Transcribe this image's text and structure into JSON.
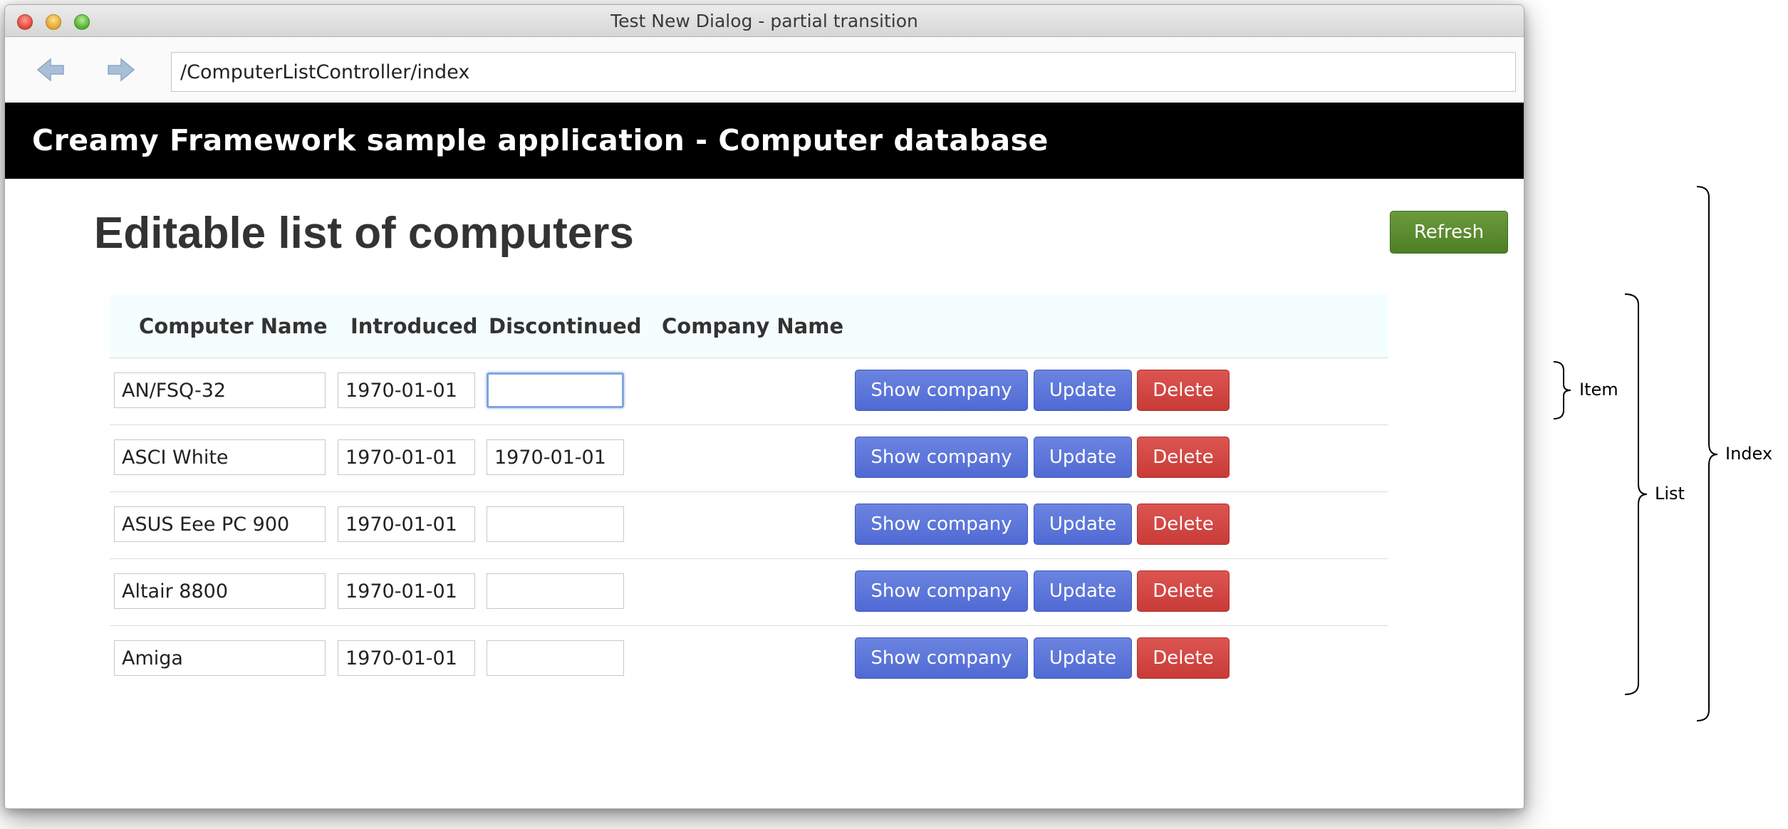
{
  "window": {
    "title": "Test New Dialog - partial transition"
  },
  "navigation": {
    "back_icon": "back-arrow-icon",
    "forward_icon": "forward-arrow-icon",
    "url": "/ComputerListController/index"
  },
  "app_header": {
    "title": "Creamy Framework sample application - Computer database"
  },
  "page": {
    "title": "Editable list of computers",
    "refresh_label": "Refresh"
  },
  "table": {
    "columns": [
      "Computer Name",
      "Introduced",
      "Discontinued",
      "Company Name"
    ],
    "rows": [
      {
        "name": "AN/FSQ-32",
        "introduced": "1970-01-01",
        "discontinued": ""
      },
      {
        "name": "ASCI White",
        "introduced": "1970-01-01",
        "discontinued": "1970-01-01"
      },
      {
        "name": "ASUS Eee PC 900",
        "introduced": "1970-01-01",
        "discontinued": ""
      },
      {
        "name": "Altair 8800",
        "introduced": "1970-01-01",
        "discontinued": ""
      },
      {
        "name": "Amiga",
        "introduced": "1970-01-01",
        "discontinued": ""
      }
    ],
    "buttons": {
      "show_company": "Show company",
      "update": "Update",
      "delete": "Delete"
    }
  },
  "annotations": {
    "item": "Item",
    "list": "List",
    "index": "Index"
  },
  "colors": {
    "header_bg": "#000000",
    "refresh_green": "#5a8a2e",
    "primary_blue": "#5b74d8",
    "danger_red": "#d2433f",
    "table_header_bg": "#f5fefe"
  }
}
